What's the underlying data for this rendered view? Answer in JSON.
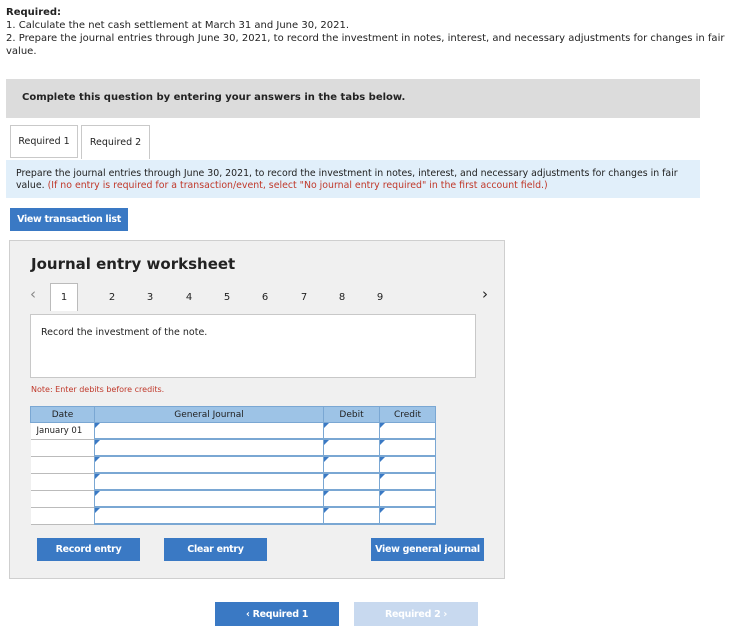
{
  "requirements": {
    "title": "Required:",
    "item1": "1. Calculate the net cash settlement at March 31 and June 30, 2021.",
    "item2": "2. Prepare the journal entries through June 30, 2021, to record the investment in notes, interest, and necessary adjustments for changes in fair value."
  },
  "complete_banner": "Complete this question by entering your answers in the tabs below.",
  "tabs": [
    {
      "label": "Required 1"
    },
    {
      "label": "Required 2"
    }
  ],
  "instruction": {
    "text": "Prepare the journal entries through June 30, 2021, to record the investment in notes, interest, and necessary adjustments for changes in fair value.",
    "note": "(If no entry is required for a transaction/event, select \"No journal entry required\" in the first account field.)"
  },
  "view_transaction_list": "View transaction list",
  "worksheet": {
    "title": "Journal entry worksheet",
    "pages": [
      "1",
      "2",
      "3",
      "4",
      "5",
      "6",
      "7",
      "8",
      "9"
    ],
    "active_page": "1",
    "prev_icon": "‹",
    "next_icon": "›",
    "description": "Record the investment of the note.",
    "note": "Note: Enter debits before credits.",
    "table": {
      "headers": [
        "Date",
        "General Journal",
        "Debit",
        "Credit"
      ],
      "rows": [
        {
          "date": "January 01",
          "account": "",
          "debit": "",
          "credit": ""
        },
        {
          "date": "",
          "account": "",
          "debit": "",
          "credit": ""
        },
        {
          "date": "",
          "account": "",
          "debit": "",
          "credit": ""
        },
        {
          "date": "",
          "account": "",
          "debit": "",
          "credit": ""
        },
        {
          "date": "",
          "account": "",
          "debit": "",
          "credit": ""
        },
        {
          "date": "",
          "account": "",
          "debit": "",
          "credit": ""
        }
      ]
    },
    "buttons": {
      "record": "Record entry",
      "clear": "Clear entry",
      "view_general": "View general journal"
    }
  },
  "nav": {
    "prev": "‹ Required 1",
    "next": "Required 2 ›"
  },
  "colors": {
    "accent": "#3a79c4",
    "header_blue": "#9dc3e6",
    "instruction_bg": "#e1effa",
    "banner_bg": "#dcdcdc",
    "error_red": "#c0392b"
  }
}
